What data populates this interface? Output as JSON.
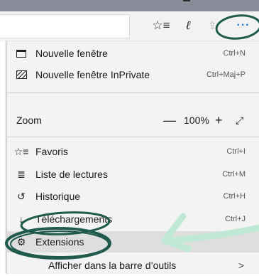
{
  "toolbar": {
    "favorites_icon": "star-list-icon",
    "notes_icon": "pen-icon",
    "share_icon": "share-icon",
    "more_icon": "more-icon",
    "more_glyph": "···",
    "fav_glyph": "☆≡",
    "pen_glyph": "ℓ",
    "share_glyph": "⇪"
  },
  "menu": {
    "items": [
      {
        "label": "Nouvelle fenêtre",
        "shortcut": "Ctrl+N",
        "icon": "window-icon"
      },
      {
        "label": "Nouvelle fenêtre InPrivate",
        "shortcut": "Ctrl+Maj+P",
        "icon": "inprivate-icon"
      },
      {
        "label": "Favoris",
        "shortcut": "Ctrl+I",
        "icon": "favorites-icon",
        "glyph": "☆≡"
      },
      {
        "label": "Liste de lectures",
        "shortcut": "Ctrl+M",
        "icon": "reading-list-icon",
        "glyph": "≣"
      },
      {
        "label": "Historique",
        "shortcut": "Ctrl+H",
        "icon": "history-icon",
        "glyph": "↺"
      },
      {
        "label": "Téléchargements",
        "shortcut": "Ctrl+J",
        "icon": "download-icon",
        "glyph": "↓"
      },
      {
        "label": "Extensions",
        "shortcut": "",
        "icon": "extensions-icon",
        "glyph": "⚙"
      },
      {
        "label": "Afficher dans la barre d’outils",
        "shortcut": "",
        "icon": "",
        "glyph": ""
      }
    ],
    "zoom": {
      "label": "Zoom",
      "value": "100%",
      "minus": "—",
      "plus": "+",
      "expand": "⤢"
    },
    "submenu_chevron": ">"
  },
  "annotation": {
    "color": "#1f5a4c",
    "arrow_color": "#bfe8d5"
  }
}
